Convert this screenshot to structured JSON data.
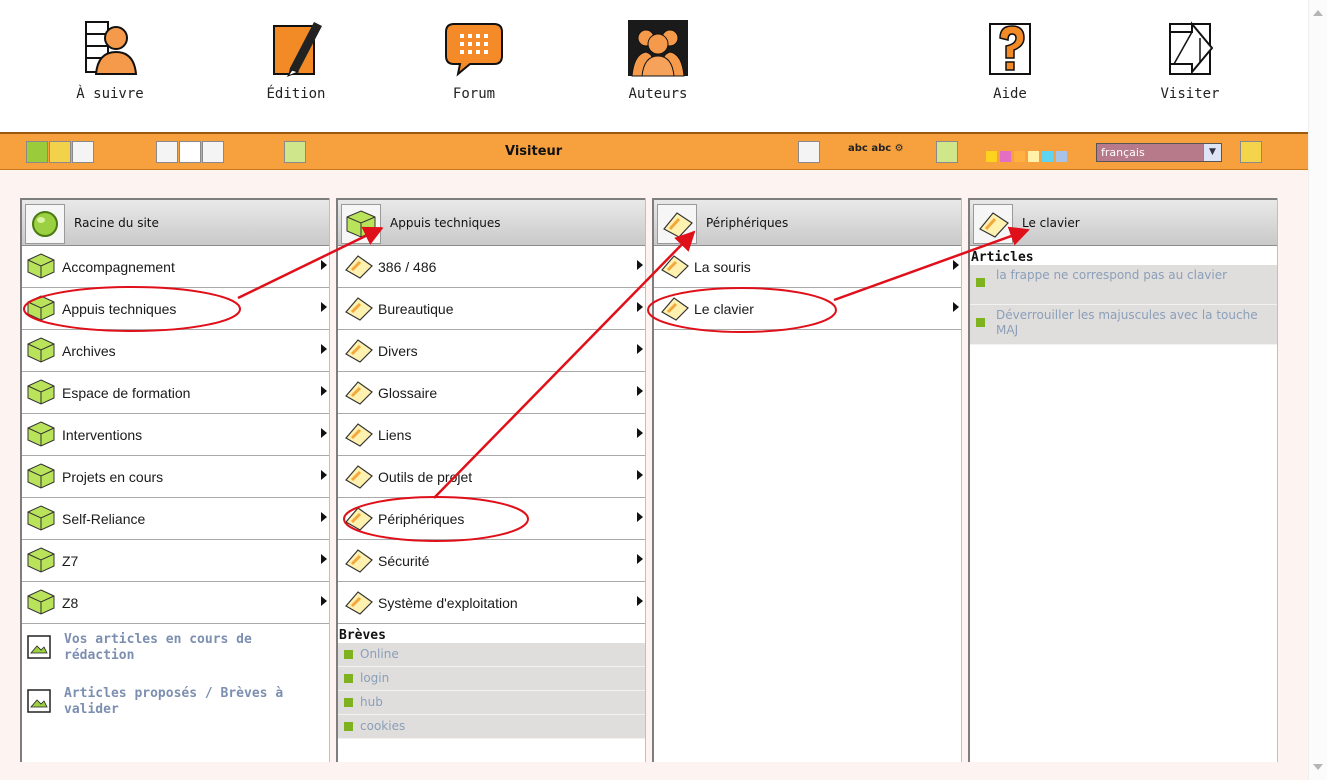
{
  "nav": {
    "items": [
      {
        "label": "À suivre",
        "icon": "person-list-icon"
      },
      {
        "label": "Édition",
        "icon": "pen-icon"
      },
      {
        "label": "Forum",
        "icon": "speech-bubble-icon"
      },
      {
        "label": "Auteurs",
        "icon": "people-icon"
      },
      {
        "label": "Aide",
        "icon": "question-icon"
      },
      {
        "label": "Visiter",
        "icon": "arrow-icon"
      }
    ]
  },
  "toolbar": {
    "title": "Visiteur",
    "language": "français",
    "colors": [
      "#ffd21f",
      "#e36fc4",
      "#ffb040",
      "#fff1a8",
      "#5fd4f0",
      "#a7c4e8"
    ]
  },
  "columns": {
    "c1": {
      "title": "Racine du site",
      "items": [
        "Accompagnement",
        "Appuis techniques",
        "Archives",
        "Espace de formation",
        "Interventions",
        "Projets en cours",
        "Self-Reliance",
        "Z7",
        "Z8"
      ],
      "links": [
        "Vos articles en cours de rédaction",
        "Articles proposés / Brèves à valider"
      ]
    },
    "c2": {
      "title": "Appuis techniques",
      "items": [
        "386 / 486",
        "Bureautique",
        "Divers",
        "Glossaire",
        "Liens",
        "Outils de projet",
        "Périphériques",
        "Sécurité",
        "Système d'exploitation"
      ],
      "section": "Brèves",
      "breves": [
        "Online",
        "login",
        "hub",
        "cookies"
      ]
    },
    "c3": {
      "title": "Périphériques",
      "items": [
        "La souris",
        "Le clavier"
      ]
    },
    "c4": {
      "title": "Le clavier",
      "section": "Articles",
      "articles": [
        "la frappe ne correspond pas au clavier",
        "Déverrouiller les majuscules avec la touche MAJ"
      ]
    }
  },
  "accent": {
    "orange": "#f6a13d",
    "annotation": "#e0101a"
  }
}
